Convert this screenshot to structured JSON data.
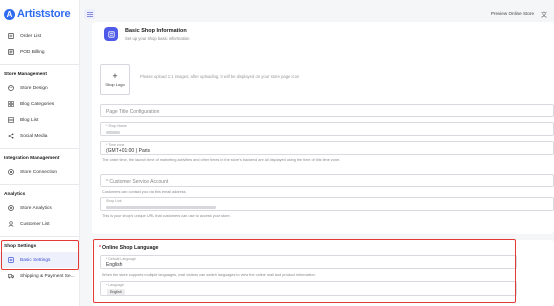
{
  "brand": {
    "mark": "A",
    "name": "Artiststore"
  },
  "sidebar": {
    "top_items": [
      {
        "label": "Order List",
        "icon": "order-icon"
      },
      {
        "label": "POD Billing",
        "icon": "billing-icon"
      }
    ],
    "sections": [
      {
        "title": "Store Management",
        "items": [
          {
            "label": "Store Design",
            "icon": "palette-icon"
          },
          {
            "label": "Blog Categories",
            "icon": "grid-icon"
          },
          {
            "label": "Blog List",
            "icon": "list-icon"
          },
          {
            "label": "Social Media",
            "icon": "share-icon"
          }
        ]
      },
      {
        "title": "Integration Management",
        "items": [
          {
            "label": "Store Connection",
            "icon": "connection-icon"
          }
        ]
      },
      {
        "title": "Analytics",
        "items": [
          {
            "label": "Store Analytics",
            "icon": "analytics-icon"
          },
          {
            "label": "Customer List",
            "icon": "customer-icon"
          }
        ]
      },
      {
        "title": "Shop Settings",
        "items": [
          {
            "label": "Basic Settings",
            "icon": "settings-icon",
            "active": true
          },
          {
            "label": "Shipping & Payment Se...",
            "icon": "truck-icon"
          }
        ]
      }
    ]
  },
  "topbar": {
    "preview_label": "Preview Online Store",
    "lang_icon": "translate-icon"
  },
  "basic_info": {
    "title": "Basic Shop Information",
    "subtitle": "Set up your shop basic information",
    "logo_label": "Shop Logo",
    "logo_hint": "Please upload 1:1 images; after uploading, it will be displayed on your store page icon",
    "page_title_placeholder": "Page Title Configuration",
    "shop_name_label": "* Shop Name",
    "time_zone_label": "* Time zone",
    "time_zone_value": "(GMT+01:00 ) Paris",
    "time_zone_help": "The order time, the launch time of marketing activities and other times in the store's backend are all displayed using the time of this time zone.",
    "email_placeholder": "* Customer Service Account",
    "email_help": "Customers can contact you via this email address.",
    "url_label": "Shop Link",
    "url_help": "This is your shop's unique URL that customers can use to access your store."
  },
  "language": {
    "title": "Online Shop Language",
    "default_label": "* Default Language",
    "default_value": "English",
    "help": "When the store supports multiple languages, mall visitors can switch languages to view the online mall and product information.",
    "lang_label": "* Language",
    "lang_tag": "English"
  },
  "colors": {
    "accent": "#2f6bf0",
    "active_bg": "#eef0fb",
    "highlight": "#e53935"
  }
}
